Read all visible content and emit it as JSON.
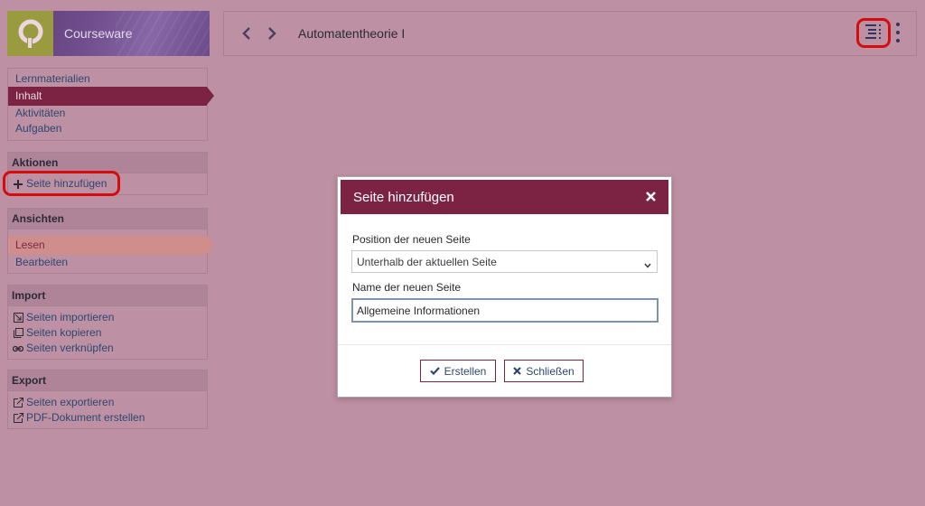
{
  "header": {
    "app_title": "Courseware",
    "page_title": "Automatentheorie I",
    "icons": {
      "logo": "courseware-logo-icon",
      "prev": "chevron-left-icon",
      "next": "chevron-right-icon",
      "toc": "table-of-contents-icon",
      "more": "more-vertical-icon"
    }
  },
  "sidebar": {
    "nav": {
      "items": [
        {
          "label": "Lernmaterialien",
          "active": false
        },
        {
          "label": "Inhalt",
          "active": true
        },
        {
          "label": "Aktivitäten",
          "active": false
        },
        {
          "label": "Aufgaben",
          "active": false
        }
      ]
    },
    "aktionen": {
      "heading": "Aktionen",
      "items": [
        {
          "label": "Seite hinzufügen",
          "icon": "plus-icon"
        }
      ]
    },
    "ansichten": {
      "heading": "Ansichten",
      "items": [
        {
          "label": "Lesen",
          "active": true
        },
        {
          "label": "Bearbeiten",
          "active": false
        }
      ]
    },
    "import": {
      "heading": "Import",
      "items": [
        {
          "label": "Seiten importieren",
          "icon": "import-icon"
        },
        {
          "label": "Seiten kopieren",
          "icon": "copy-icon"
        },
        {
          "label": "Seiten verknüpfen",
          "icon": "link-icon"
        }
      ]
    },
    "export": {
      "heading": "Export",
      "items": [
        {
          "label": "Seiten exportieren",
          "icon": "export-icon"
        },
        {
          "label": "PDF-Dokument erstellen",
          "icon": "export-icon"
        }
      ]
    }
  },
  "dialog": {
    "title": "Seite hinzufügen",
    "close_icon": "close-icon",
    "position_label": "Position der neuen Seite",
    "position_value": "Unterhalb der aktuellen Seite",
    "name_label": "Name der neuen Seite",
    "name_value": "Allgemeine Informationen",
    "create_label": "Erstellen",
    "close_label": "Schließen"
  },
  "colors": {
    "overlay_background": "#bd91a3",
    "accent": "#7c2242",
    "highlight_ring": "#d50c0c",
    "link": "#2e4670"
  }
}
